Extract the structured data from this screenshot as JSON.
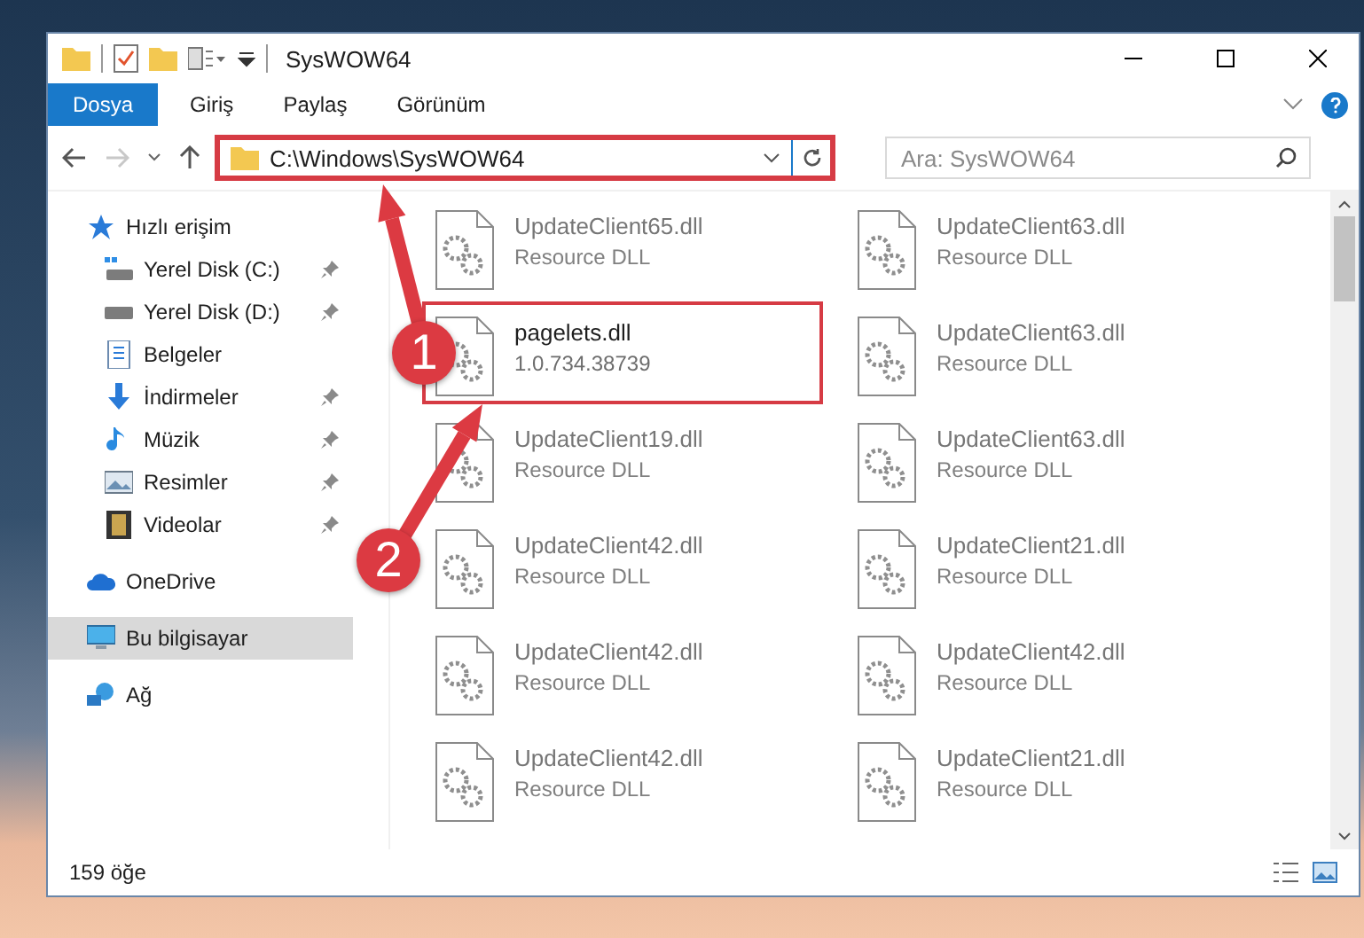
{
  "window": {
    "title": "SysWOW64"
  },
  "ribbon_tabs": [
    {
      "label": "Dosya",
      "kind": "file"
    },
    {
      "label": "Giriş",
      "kind": "tab"
    },
    {
      "label": "Paylaş",
      "kind": "tab"
    },
    {
      "label": "Görünüm",
      "kind": "tab"
    }
  ],
  "address_bar": {
    "path": "C:\\Windows\\SysWOW64",
    "highlighted": true
  },
  "search": {
    "placeholder": "Ara: SysWOW64"
  },
  "sidebar": {
    "items": [
      {
        "label": "Hızlı erişim",
        "kind": "star",
        "selected": false,
        "children": [
          {
            "label": "Yerel Disk (C:)",
            "kind": "system-drive",
            "pinned": true,
            "selected": false
          },
          {
            "label": "Yerel Disk (D:)",
            "kind": "drive",
            "pinned": true,
            "selected": false
          },
          {
            "label": "Belgeler",
            "kind": "documents",
            "pinned": false,
            "selected": false
          },
          {
            "label": "İndirmeler",
            "kind": "downloads",
            "pinned": true,
            "selected": false
          },
          {
            "label": "Müzik",
            "kind": "music",
            "pinned": true,
            "selected": false
          },
          {
            "label": "Resimler",
            "kind": "pictures",
            "pinned": true,
            "selected": false
          },
          {
            "label": "Videolar",
            "kind": "videos",
            "pinned": true,
            "selected": false
          }
        ]
      },
      {
        "label": "OneDrive",
        "kind": "cloud",
        "selected": false
      },
      {
        "label": "Bu bilgisayar",
        "kind": "computer",
        "selected": true
      },
      {
        "label": "Ağ",
        "kind": "network",
        "selected": false
      }
    ]
  },
  "files": [
    {
      "name": "UpdateClient65.dll",
      "detail": "Resource DLL",
      "blurred": true,
      "highlighted": false
    },
    {
      "name": "UpdateClient63.dll",
      "detail": "Resource DLL",
      "blurred": true,
      "highlighted": false
    },
    {
      "name": "pagelets.dll",
      "detail": "1.0.734.38739",
      "blurred": false,
      "highlighted": true
    },
    {
      "name": "UpdateClient63.dll",
      "detail": "Resource DLL",
      "blurred": true,
      "highlighted": false
    },
    {
      "name": "UpdateClient19.dll",
      "detail": "Resource DLL",
      "blurred": true,
      "highlighted": false
    },
    {
      "name": "UpdateClient63.dll",
      "detail": "Resource DLL",
      "blurred": true,
      "highlighted": false
    },
    {
      "name": "UpdateClient42.dll",
      "detail": "Resource DLL",
      "blurred": true,
      "highlighted": false
    },
    {
      "name": "UpdateClient21.dll",
      "detail": "Resource DLL",
      "blurred": true,
      "highlighted": false
    },
    {
      "name": "UpdateClient42.dll",
      "detail": "Resource DLL",
      "blurred": true,
      "highlighted": false
    },
    {
      "name": "UpdateClient42.dll",
      "detail": "Resource DLL",
      "blurred": true,
      "highlighted": false
    },
    {
      "name": "UpdateClient42.dll",
      "detail": "Resource DLL",
      "blurred": true,
      "highlighted": false
    },
    {
      "name": "UpdateClient21.dll",
      "detail": "Resource DLL",
      "blurred": true,
      "highlighted": false
    }
  ],
  "status_bar": {
    "item_count": "159 öğe"
  },
  "annotations": [
    {
      "number": "1"
    },
    {
      "number": "2"
    }
  ]
}
